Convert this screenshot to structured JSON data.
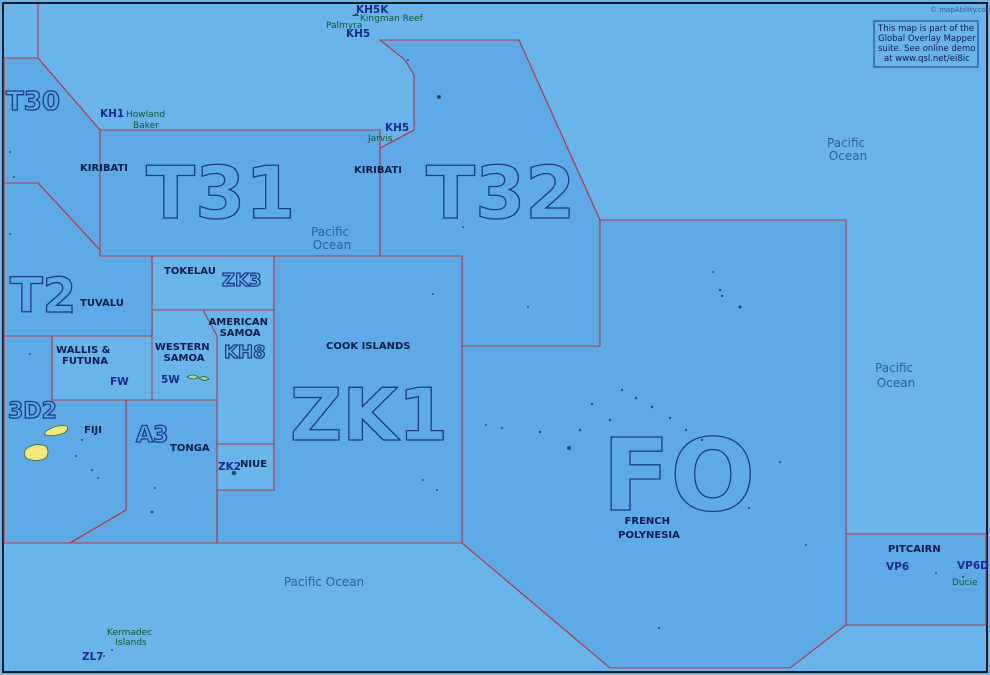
{
  "map": {
    "ocean_color": "#6ab4ec",
    "zone_color": "#5eaae6",
    "border_color": "#b03a4c",
    "land_color": "#f0e87a",
    "watermark": "© mapAbility.com",
    "note": [
      "This map is part of the",
      "Global Overlay Mapper",
      "suite. See online demo",
      "at www.qsl.net/ei8ic"
    ]
  },
  "oceans": [
    "Pacific\nOcean",
    "Pacific\nOcean",
    "Pacific\nOcean",
    "Pacific Ocean"
  ],
  "ocean_labels": {
    "top_right": [
      "Pacific",
      "Ocean"
    ],
    "center": [
      "Pacific",
      "Ocean"
    ],
    "right": [
      "Pacific",
      "Ocean"
    ],
    "bottom": "Pacific Ocean"
  },
  "zones": {
    "t30": "T30",
    "t31": "T31",
    "t32": "T32",
    "t2": "T2",
    "d32": "3D2",
    "a3": "A3",
    "zk1": "ZK1",
    "fo": "FO",
    "zk3": "ZK3",
    "kh8": "KH8"
  },
  "countries": {
    "kiribati_w": "KIRIBATI",
    "kiribati_e": "KIRIBATI",
    "tokelau": "TOKELAU",
    "tuvalu": "TUVALU",
    "wallis": [
      "WALLIS &",
      "FUTUNA"
    ],
    "western_samoa": [
      "WESTERN",
      "SAMOA"
    ],
    "american_samoa": [
      "AMERICAN",
      "SAMOA"
    ],
    "cook_islands": "COOK ISLANDS",
    "fiji": "FIJI",
    "tonga": "TONGA",
    "niue": "NIUE",
    "french_polynesia": [
      "FRENCH",
      "POLYNESIA"
    ],
    "pitcairn": "PITCAIRN"
  },
  "prefixes": {
    "kh5k": "KH5K",
    "kh5_palmyra": "KH5",
    "kh1": "KH1",
    "kh5_jarvis": "KH5",
    "fw": "FW",
    "w5": "5W",
    "zk2": "ZK2",
    "vp6": "VP6",
    "vp6d": "VP6D",
    "zl7": "ZL7"
  },
  "islands": {
    "kingman": "Kingman Reef",
    "palmyra": "Palmyra",
    "howland": "Howland",
    "baker": "Baker",
    "jarvis": "Jarvis",
    "ducie": "Ducie",
    "kermadec": [
      "Kermadec",
      "Islands"
    ]
  }
}
